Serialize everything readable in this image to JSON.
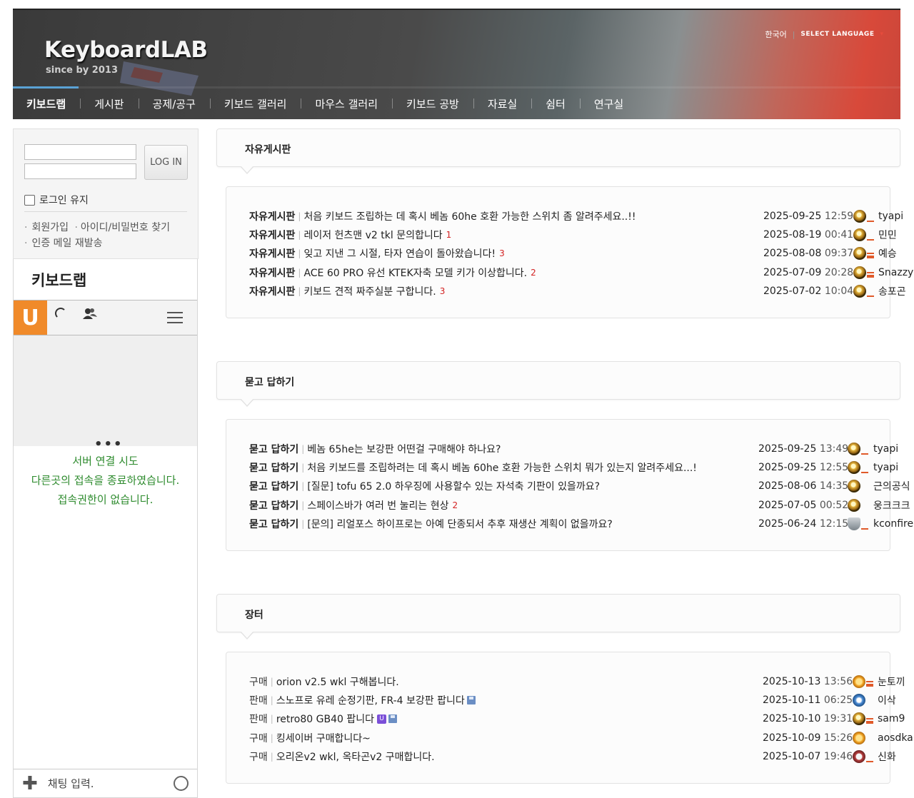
{
  "header": {
    "logo_main": "KeyboardLAB",
    "logo_sub": "since by 2013",
    "lang_current": "한국어",
    "lang_select": "SELECT LANGUAGE",
    "lang_arrow": "▾"
  },
  "nav": [
    "키보드랩",
    "게시판",
    "공제/공구",
    "키보드 갤러리",
    "마우스 갤러리",
    "키보드 공방",
    "자료실",
    "쉼터",
    "연구실"
  ],
  "login": {
    "button": "LOG IN",
    "keep": "로그인 유지",
    "link_signup": "회원가입",
    "link_find": "아이디/비밀번호 찾기",
    "link_mail": "인증 메일 재발송"
  },
  "chat": {
    "title": "키보드랩",
    "logo_letter": "U",
    "dots": "•••",
    "msg1": "서버 연결 시도",
    "msg2": "다른곳의 접속을 종료하였습니다.",
    "msg3": "접속권한이 없습니다.",
    "input_placeholder": "채팅 입력."
  },
  "sections": [
    {
      "title": "자유게시판",
      "rows": [
        {
          "cat": "자유게시판",
          "title": "처음 키보드 조립하는 데 혹시 베놈 60he 호환 가능한 스위치 좀 알려주세요..!!",
          "count": "",
          "date": "2025-09-25",
          "time": "12:59",
          "icon": "medal",
          "level": "single",
          "user": "tyapi"
        },
        {
          "cat": "자유게시판",
          "title": "레이저 헌츠맨 v2 tkl 문의합니다",
          "count": "1",
          "date": "2025-08-19",
          "time": "00:41",
          "icon": "medal",
          "level": "single",
          "user": "민민"
        },
        {
          "cat": "자유게시판",
          "title": "잊고 지낸 그 시절, 타자 연습이 돌아왔습니다!",
          "count": "3",
          "date": "2025-08-08",
          "time": "09:37",
          "icon": "medal",
          "level": "triple",
          "user": "예승"
        },
        {
          "cat": "자유게시판",
          "title": "ACE 60 PRO 유선 KTEK자축 모델 키가 이상합니다.",
          "count": "2",
          "date": "2025-07-09",
          "time": "20:28",
          "icon": "medal",
          "level": "triple",
          "user": "Snazzy"
        },
        {
          "cat": "자유게시판",
          "title": "키보드 견적 짜주실분 구합니다.",
          "count": "3",
          "date": "2025-07-02",
          "time": "10:04",
          "icon": "medal",
          "level": "single",
          "user": "송포곤"
        }
      ]
    },
    {
      "title": "묻고 답하기",
      "rows": [
        {
          "cat": "묻고 답하기",
          "title": "베놈 65he는 보강판 어떤걸 구매해야 하나요?",
          "count": "",
          "date": "2025-09-25",
          "time": "13:49",
          "icon": "medal",
          "level": "single",
          "user": "tyapi"
        },
        {
          "cat": "묻고 답하기",
          "title": "처음 키보드를 조립하려는 데 혹시 베놈 60he 호환 가능한 스위치 뭐가 있는지 알려주세요...!",
          "count": "",
          "date": "2025-09-25",
          "time": "12:55",
          "icon": "medal",
          "level": "single",
          "user": "tyapi"
        },
        {
          "cat": "묻고 답하기",
          "title": "[질문] tofu 65 2.0 하우징에 사용할수 있는 자석축 기판이 있을까요?",
          "count": "",
          "date": "2025-08-06",
          "time": "14:35",
          "icon": "medal",
          "level": "none",
          "user": "근의공식"
        },
        {
          "cat": "묻고 답하기",
          "title": "스페이스바가 여러 번 눌리는 현상",
          "count": "2",
          "date": "2025-07-05",
          "time": "00:52",
          "icon": "medal",
          "level": "none",
          "user": "웅크크크"
        },
        {
          "cat": "묻고 답하기",
          "title": "[문의] 리얼포스 하이프로는 아예 단종되서 추후 재생산 계획이 없을까요?",
          "count": "",
          "date": "2025-06-24",
          "time": "12:15",
          "icon": "shield",
          "level": "single",
          "user": "kconfire"
        }
      ]
    },
    {
      "title": "장터",
      "rows": [
        {
          "cat": "구매",
          "title": "orion v2.5 wkl 구해봅니다.",
          "count": "",
          "date": "2025-10-13",
          "time": "13:56",
          "icon": "sun",
          "level": "triple",
          "user": "눈토끼",
          "badge": ""
        },
        {
          "cat": "판매",
          "title": "스노프로 유레 순정기판, FR-4 보강판 팝니다",
          "count": "",
          "date": "2025-10-11",
          "time": "06:25",
          "icon": "blue",
          "level": "none",
          "user": "이삭",
          "badge": "floppy"
        },
        {
          "cat": "판매",
          "title": "retro80 GB40 팝니다",
          "count": "",
          "date": "2025-10-10",
          "time": "19:31",
          "icon": "medal",
          "level": "triple",
          "user": "sam9",
          "badge": "u-floppy"
        },
        {
          "cat": "구매",
          "title": "킹세이버 구매합니다~",
          "count": "",
          "date": "2025-10-09",
          "time": "15:26",
          "icon": "sun",
          "level": "none",
          "user": "aosdka",
          "badge": ""
        },
        {
          "cat": "구매",
          "title": "오리온v2 wkl, 옥타곤v2 구매합니다.",
          "count": "",
          "date": "2025-10-07",
          "time": "19:46",
          "icon": "star",
          "level": "single",
          "user": "신화",
          "badge": ""
        }
      ]
    }
  ],
  "colors": {
    "accent_underline": "#4d9bd2",
    "count_red": "#d32222",
    "chat_green": "#2e8b2e",
    "u_logo": "#f08a2a"
  }
}
